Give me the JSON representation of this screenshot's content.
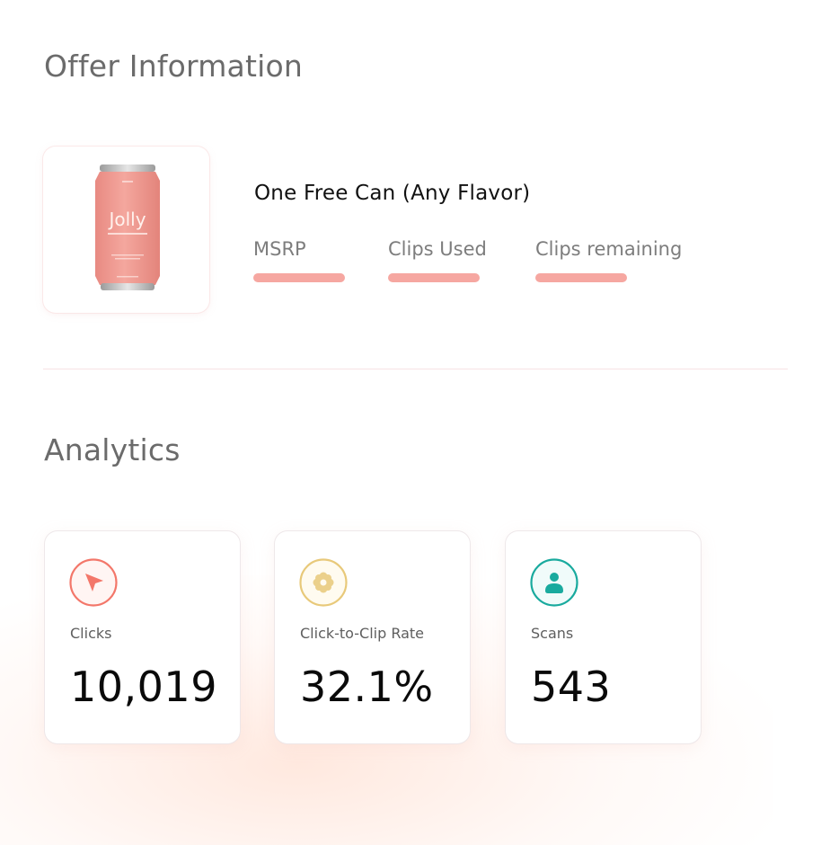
{
  "offer_section": {
    "title": "Offer Information",
    "product": {
      "brand_text": "Jolly",
      "image_icon": "soda-can-image"
    },
    "offer_name": "One Free Can (Any Flavor)",
    "stats": [
      {
        "label": "MSRP"
      },
      {
        "label": "Clips Used"
      },
      {
        "label": "Clips remaining"
      }
    ]
  },
  "analytics_section": {
    "title": "Analytics",
    "metrics": [
      {
        "label": "Clicks",
        "value": "10,019",
        "icon": "cursor-arrow-icon",
        "color": "#f3776a"
      },
      {
        "label": "Click-to-Clip Rate",
        "value": "32.1%",
        "icon": "flower-icon",
        "color": "#e8c97a"
      },
      {
        "label": "Scans",
        "value": "543",
        "icon": "user-icon",
        "color": "#19aa9e"
      }
    ]
  },
  "colors": {
    "accent_bar": "#f6a7a1",
    "title_gray": "#6b6b6b",
    "divider": "#f7e2e4"
  }
}
